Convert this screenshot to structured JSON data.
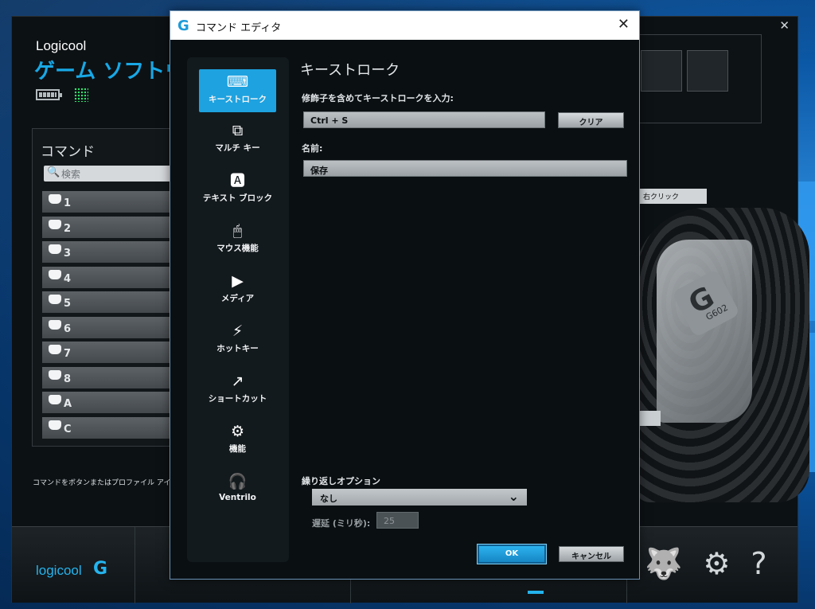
{
  "app": {
    "brand_top": "Logicool",
    "brand_title": "ゲーム ソフトウ",
    "commands_title": "コマンド",
    "search_placeholder": "検索",
    "command_items": [
      "1",
      "2",
      "3",
      "4",
      "5",
      "6",
      "7",
      "8",
      "A",
      "C"
    ],
    "hint_text": "コマンドをボタンまたはプロファイル アイ",
    "right_click_label": "右クリック",
    "footer_logo": "logicool",
    "mouse_model": "G602",
    "accent_color": "#1ea2e0"
  },
  "dialog": {
    "title": "コマンド エディタ",
    "sidebar": [
      {
        "label": "キーストローク",
        "icon": "keycap-icon",
        "active": true
      },
      {
        "label": "マルチ キー",
        "icon": "multikey-icon",
        "active": false
      },
      {
        "label": "テキスト ブロック",
        "icon": "text-block-icon",
        "active": false
      },
      {
        "label": "マウス機能",
        "icon": "mouse-icon",
        "active": false
      },
      {
        "label": "メディア",
        "icon": "play-icon",
        "active": false
      },
      {
        "label": "ホットキー",
        "icon": "hotkey-icon",
        "active": false
      },
      {
        "label": "ショートカット",
        "icon": "shortcut-arrow-icon",
        "active": false
      },
      {
        "label": "機能",
        "icon": "function-gear-icon",
        "active": false
      },
      {
        "label": "Ventrilo",
        "icon": "headset-icon",
        "active": false
      }
    ],
    "section_title": "キーストローク",
    "keystroke_label": "修飾子を含めてキーストロークを入力:",
    "keystroke_value": "Ctrl + S",
    "clear_button": "クリア",
    "name_label": "名前:",
    "name_value": "保存",
    "repeat_label": "繰り返しオプション",
    "repeat_value": "なし",
    "delay_label": "遅延 (ミリ秒):",
    "delay_value": "25",
    "ok_button": "OK",
    "cancel_button": "キャンセル"
  }
}
